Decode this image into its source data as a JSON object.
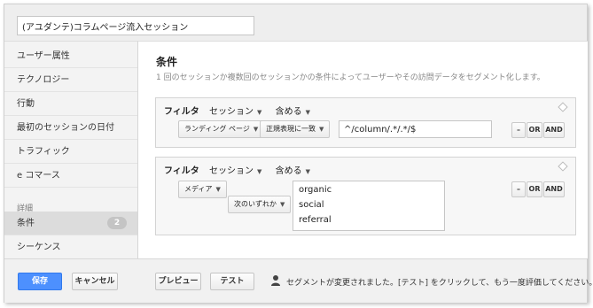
{
  "segment_name": "(アユダンテ)コラムページ流入セッション",
  "sidebar": {
    "items": [
      {
        "label": "ユーザー属性"
      },
      {
        "label": "テクノロジー"
      },
      {
        "label": "行動"
      },
      {
        "label": "最初のセッションの日付"
      },
      {
        "label": "トラフィック"
      },
      {
        "label": "e コマース"
      }
    ],
    "section_label": "詳細",
    "advanced_items": [
      {
        "label": "条件",
        "badge": "2"
      },
      {
        "label": "シーケンス"
      }
    ]
  },
  "main": {
    "title": "条件",
    "description": "1 回のセッションか複数回のセッションかの条件によってユーザーやその訪問データをセグメント化します。",
    "filters": [
      {
        "filter_label": "フィルタ",
        "scope": "セッション",
        "mode": "含める",
        "dimension": "ランディング ページ",
        "operator": "正規表現に一致",
        "value": "^/column/.*/.*/$",
        "btn_minus": "–",
        "btn_or": "OR",
        "btn_and": "AND"
      },
      {
        "filter_label": "フィルタ",
        "scope": "セッション",
        "mode": "含める",
        "dimension": "メディア",
        "operator": "次のいずれか",
        "values": [
          "organic",
          "social",
          "referral"
        ],
        "btn_minus": "–",
        "btn_or": "OR",
        "btn_and": "AND"
      }
    ]
  },
  "footer": {
    "save": "保存",
    "cancel": "キャンセル",
    "preview": "プレビュー",
    "test": "テスト",
    "notice": "セグメントが変更されました。[テスト] をクリックして、もう一度評価してください。"
  },
  "colors": {
    "primary_button": "#4d90fe",
    "frame_bg": "#eeeeee"
  }
}
